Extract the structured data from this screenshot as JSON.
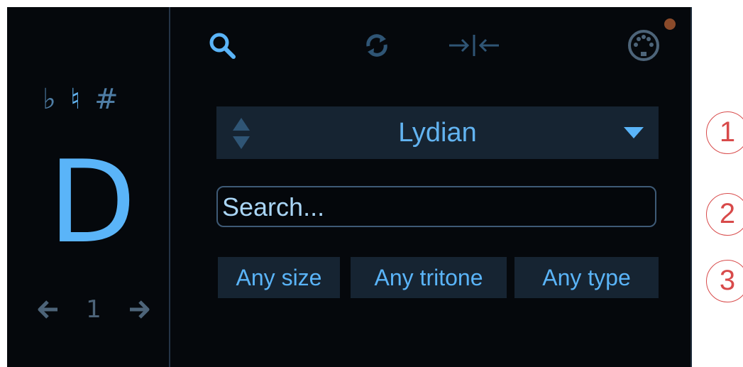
{
  "accidentals": {
    "flat": "♭",
    "natural": "♮",
    "sharp": "#",
    "selected": "natural"
  },
  "key": {
    "root": "D",
    "octave": "1"
  },
  "toolbar": {
    "icons": [
      "search-icon",
      "refresh-icon",
      "collapse-icon",
      "midi-icon"
    ]
  },
  "mode_selector": {
    "value": "Lydian"
  },
  "search": {
    "placeholder": "Search..."
  },
  "filters": {
    "size": "Any size",
    "tritone": "Any tritone",
    "type": "Any type"
  },
  "callouts": [
    "1",
    "2",
    "3"
  ],
  "colors": {
    "background": "#05080c",
    "accent": "#5ab4f8",
    "control_bg": "#162432",
    "callout": "#d84a4a"
  }
}
